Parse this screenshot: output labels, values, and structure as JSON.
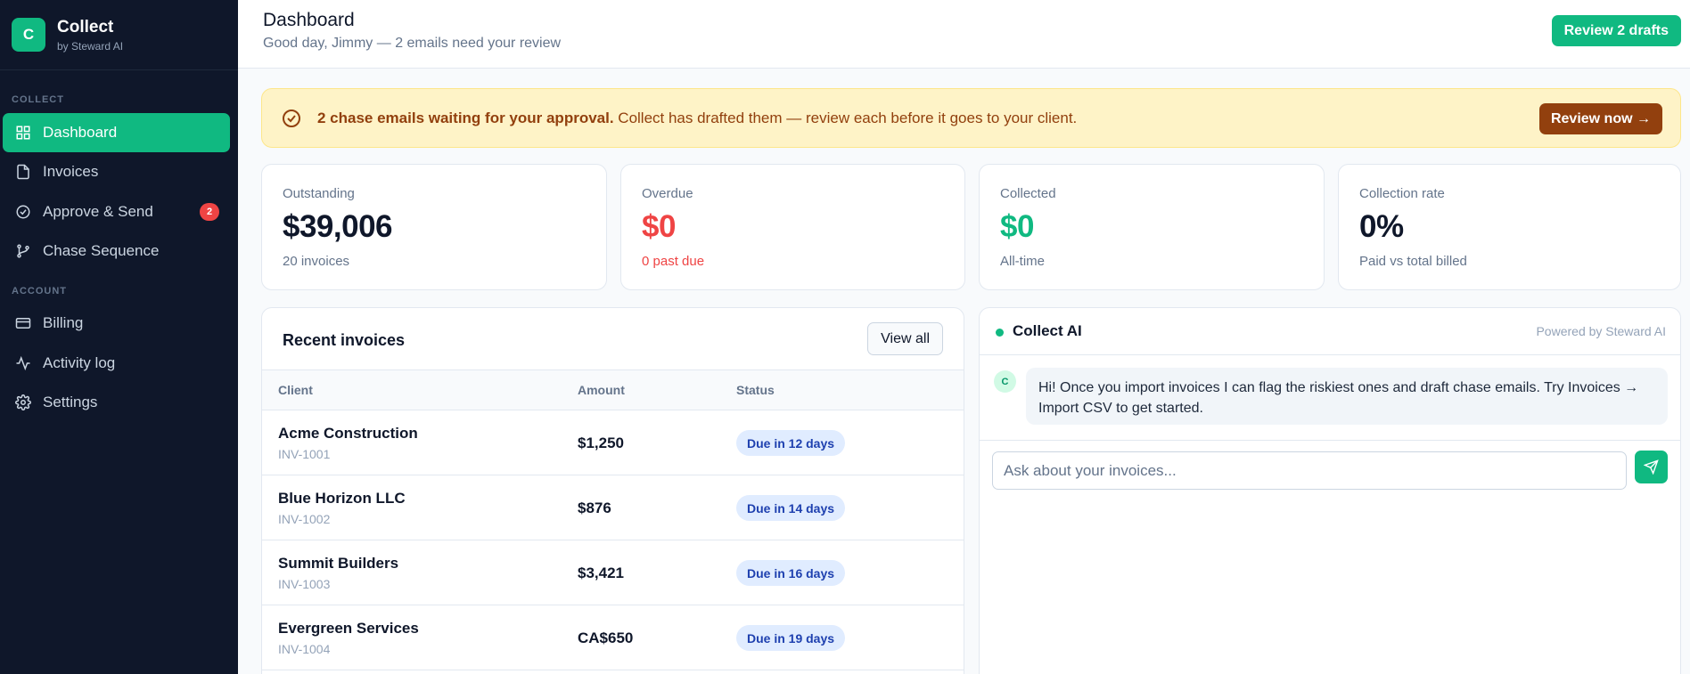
{
  "brand": {
    "logo": "C",
    "name": "Collect",
    "sub": "by Steward AI"
  },
  "sidebar": {
    "section_collect": "COLLECT",
    "section_account": "ACCOUNT",
    "items": [
      {
        "label": "Dashboard",
        "icon": "grid-icon"
      },
      {
        "label": "Invoices",
        "icon": "file-icon"
      },
      {
        "label": "Approve & Send",
        "icon": "check-circle-icon",
        "badge": "2"
      },
      {
        "label": "Chase Sequence",
        "icon": "branch-icon"
      },
      {
        "label": "Billing",
        "icon": "credit-card-icon"
      },
      {
        "label": "Activity log",
        "icon": "activity-icon"
      },
      {
        "label": "Settings",
        "icon": "gear-icon"
      }
    ]
  },
  "header": {
    "title": "Dashboard",
    "subtitle": "Good day, Jimmy — 2 emails need your review",
    "review_button": "Review 2 drafts"
  },
  "banner": {
    "bold": "2 chase emails waiting for your approval.",
    "text": " Collect has drafted them — review each before it goes to your client.",
    "button": "Review now →"
  },
  "cards": [
    {
      "label": "Outstanding",
      "value": "$39,006",
      "sub": "20 invoices",
      "value_color": "#0f172a",
      "sub_color": "#64748b"
    },
    {
      "label": "Overdue",
      "value": "$0",
      "sub": "0 past due",
      "value_color": "#ef4444",
      "sub_color": "#ef4444"
    },
    {
      "label": "Collected",
      "value": "$0",
      "sub": "All-time",
      "value_color": "#10b981",
      "sub_color": "#64748b"
    },
    {
      "label": "Collection rate",
      "value": "0%",
      "sub": "Paid vs total billed",
      "value_color": "#0f172a",
      "sub_color": "#64748b"
    }
  ],
  "recent": {
    "title": "Recent invoices",
    "view_all": "View all",
    "columns": [
      "Client",
      "Amount",
      "Status"
    ],
    "rows": [
      {
        "client": "Acme Construction",
        "id": "INV-1001",
        "amount": "$1,250",
        "status": "Due in 12 days"
      },
      {
        "client": "Blue Horizon LLC",
        "id": "INV-1002",
        "amount": "$876",
        "status": "Due in 14 days"
      },
      {
        "client": "Summit Builders",
        "id": "INV-1003",
        "amount": "$3,421",
        "status": "Due in 16 days"
      },
      {
        "client": "Evergreen Services",
        "id": "INV-1004",
        "amount": "CA$650",
        "status": "Due in 19 days"
      }
    ]
  },
  "ai": {
    "title": "Collect AI",
    "powered": "Powered by Steward AI",
    "avatar": "C",
    "message": "Hi! Once you import invoices I can flag the riskiest ones and draft chase emails. Try Invoices → Import CSV to get started.",
    "placeholder": "Ask about your invoices..."
  },
  "colors": {
    "accent": "#10b981",
    "sidebar_bg": "#0f172a",
    "banner_bg": "#fef3c7",
    "banner_text": "#92400e",
    "danger": "#ef4444"
  }
}
